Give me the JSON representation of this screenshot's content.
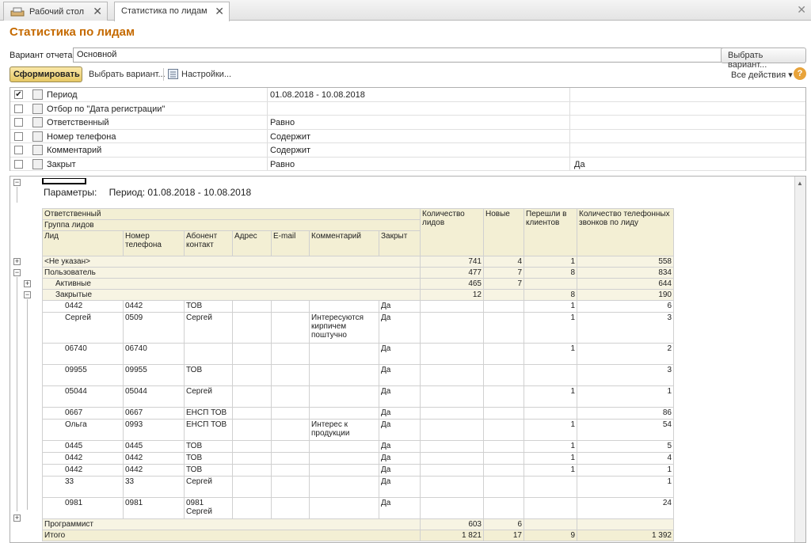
{
  "tabs": [
    {
      "label": "Рабочий стол",
      "active": false
    },
    {
      "label": "Статистика по лидам",
      "active": true
    }
  ],
  "page_title": "Статистика по лидам",
  "variant": {
    "label": "Вариант отчета:",
    "value": "Основной",
    "choose_button": "Выбрать вариант..."
  },
  "toolbar": {
    "generate": "Сформировать",
    "choose_variant": "Выбрать вариант...",
    "settings": "Настройки...",
    "all_actions": "Все действия",
    "help": "?"
  },
  "filters": [
    {
      "checked": true,
      "name": "Период",
      "condition": "01.08.2018 - 10.08.2018",
      "value": ""
    },
    {
      "checked": false,
      "name": "Отбор по \"Дата регистрации\"",
      "condition": "",
      "value": ""
    },
    {
      "checked": false,
      "name": "Ответственный",
      "condition": "Равно",
      "value": ""
    },
    {
      "checked": false,
      "name": "Номер телефона",
      "condition": "Содержит",
      "value": ""
    },
    {
      "checked": false,
      "name": "Комментарий",
      "condition": "Содержит",
      "value": ""
    },
    {
      "checked": false,
      "name": "Закрыт",
      "condition": "Равно",
      "value": "Да"
    }
  ],
  "report": {
    "params_label": "Параметры:",
    "params_value": "Период: 01.08.2018 - 10.08.2018",
    "header": {
      "responsible": "Ответственный",
      "lead_group": "Группа лидов",
      "lead": "Лид",
      "phone": "Номер телефона",
      "subscriber": "Абонент контакт",
      "address": "Адрес",
      "email": "E-mail",
      "comment": "Комментарий",
      "closed": "Закрыт",
      "lead_count": "Количество лидов",
      "new": "Новые",
      "converted": "Перешли в клиентов",
      "calls": "Количество телефонных звонков по лиду"
    },
    "groups": [
      {
        "name": "<Не указан>",
        "count": "741",
        "new": "4",
        "converted": "1",
        "calls": "558"
      },
      {
        "name": "Пользователь",
        "count": "477",
        "new": "7",
        "converted": "8",
        "calls": "834"
      },
      {
        "name": "Активные",
        "count": "465",
        "new": "7",
        "converted": "",
        "calls": "644"
      },
      {
        "name": "Закрытые",
        "count": "12",
        "new": "",
        "converted": "8",
        "calls": "190"
      }
    ],
    "rows": [
      {
        "lead": "0442",
        "phone": "0442",
        "subscriber": "ТОВ",
        "comment": "",
        "closed": "Да",
        "converted": "1",
        "calls": "6",
        "lines": 1
      },
      {
        "lead": "Сергей",
        "phone": "0509",
        "subscriber": "Сергей",
        "comment": "Интересуются кирпичем поштучно",
        "closed": "Да",
        "converted": "1",
        "calls": "3",
        "lines": 3
      },
      {
        "lead": "06740",
        "phone": "06740",
        "subscriber": "",
        "comment": "",
        "closed": "Да",
        "converted": "1",
        "calls": "2",
        "lines": 2
      },
      {
        "lead": "09955",
        "phone": "09955",
        "subscriber": "ТОВ",
        "comment": "",
        "closed": "Да",
        "converted": "",
        "calls": "3",
        "lines": 2
      },
      {
        "lead": "05044",
        "phone": "05044",
        "subscriber": "Сергей",
        "comment": "",
        "closed": "Да",
        "converted": "1",
        "calls": "1",
        "lines": 2
      },
      {
        "lead": "0667",
        "phone": "0667",
        "subscriber": "ЕНСП ТОВ",
        "comment": "",
        "closed": "Да",
        "converted": "",
        "calls": "86",
        "lines": 1
      },
      {
        "lead": "Ольга",
        "phone": "0993",
        "subscriber": "ЕНСП ТОВ",
        "comment": "Интерес к продукции",
        "closed": "Да",
        "converted": "1",
        "calls": "54",
        "lines": 2
      },
      {
        "lead": "0445",
        "phone": "0445",
        "subscriber": "ТОВ",
        "comment": "",
        "closed": "Да",
        "converted": "1",
        "calls": "5",
        "lines": 1
      },
      {
        "lead": "0442",
        "phone": "0442",
        "subscriber": "ТОВ",
        "comment": "",
        "closed": "Да",
        "converted": "1",
        "calls": "4",
        "lines": 1
      },
      {
        "lead": "0442",
        "phone": "0442",
        "subscriber": "ТОВ",
        "comment": "",
        "closed": "Да",
        "converted": "1",
        "calls": "1",
        "lines": 1
      },
      {
        "lead": "33",
        "phone": "33",
        "subscriber": "Сергей",
        "comment": "",
        "closed": "Да",
        "converted": "",
        "calls": "1",
        "lines": 2
      },
      {
        "lead": "0981",
        "phone": "0981",
        "subscriber": "0981 Сергей",
        "comment": "",
        "closed": "Да",
        "converted": "",
        "calls": "24",
        "lines": 2
      }
    ],
    "programmer": {
      "name": "Программист",
      "count": "603",
      "new": "6",
      "converted": "",
      "calls": ""
    },
    "total": {
      "name": "Итого",
      "count": "1 821",
      "new": "17",
      "converted": "9",
      "calls": "1 392"
    }
  }
}
